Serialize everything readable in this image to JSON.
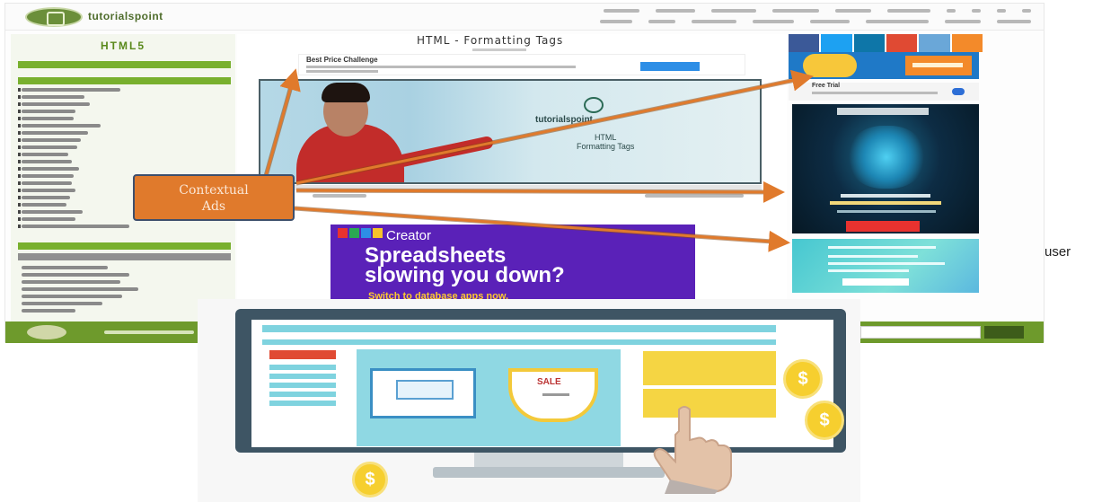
{
  "callout": {
    "line1": "Contextual",
    "line2": "Ads"
  },
  "trailing_text": "user",
  "tutorial_page": {
    "logo_text": "tutorialspoint",
    "sidebar_heading": "HTML5",
    "page_title": "HTML - Formatting Tags",
    "top_ad_title": "Best Price Challenge",
    "video_brand": "tutorialspoint",
    "video_caption_line1": "HTML",
    "video_caption_line2": "Formatting Tags",
    "zoho_ad": {
      "brand": "Creator",
      "headline_line1": "Spreadsheets",
      "headline_line2": "slowing you down?",
      "subline": "Switch to database apps now."
    },
    "right_ad_free_trial": "Free Trial",
    "colors": {
      "brand_green": "#6e9a2c",
      "callout_orange": "#e07a2c",
      "zoho_purple": "#5a21b8",
      "arrow": "#e07a2c"
    }
  },
  "illustration": {
    "coin_symbol": "$",
    "ad_card_2_text": "SALE"
  }
}
